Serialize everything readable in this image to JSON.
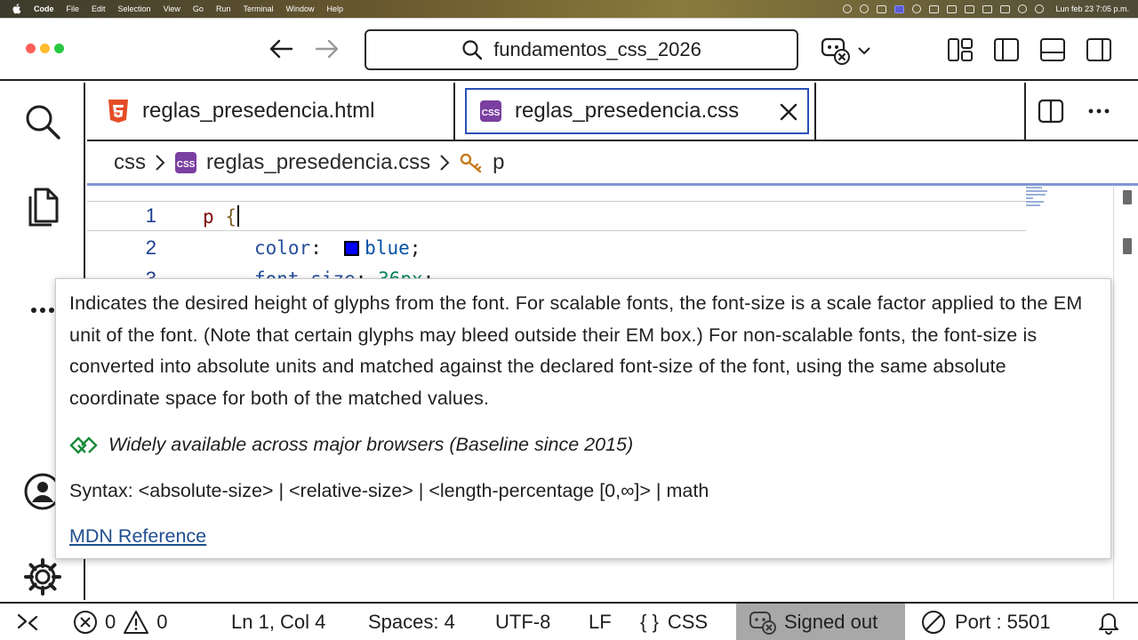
{
  "menubar": {
    "app_name": "Code",
    "items": [
      "File",
      "Edit",
      "Selection",
      "View",
      "Go",
      "Run",
      "Terminal",
      "Window",
      "Help"
    ],
    "clock": "Lun feb 23  7:05 p.m."
  },
  "titlebar": {
    "search_text": "fundamentos_css_2026",
    "icons": [
      "arrow-left-icon",
      "arrow-right-icon",
      "search-icon",
      "copilot-icon",
      "chevron-down-icon",
      "layout-icon",
      "toggle-sidebar-icon",
      "toggle-panel-icon",
      "toggle-secondary-sidebar-icon"
    ]
  },
  "activitybar": {
    "items": [
      "search-icon",
      "explorer-icon",
      "more-icon",
      "account-icon",
      "settings-icon"
    ]
  },
  "tabs": [
    {
      "label": "reglas_presedencia.html",
      "icon": "html5-icon",
      "active": false
    },
    {
      "label": "reglas_presedencia.css",
      "icon": "css-icon",
      "active": true
    }
  ],
  "breadcrumb": {
    "folder": "css",
    "file": "reglas_presedencia.css",
    "symbol": "p"
  },
  "editor": {
    "lines": [
      {
        "number": "1",
        "selector": "p",
        "open_brace": "{"
      },
      {
        "number": "2",
        "property": "color",
        "value": "blue",
        "swatch_color": "#0000ff"
      },
      {
        "number": "3",
        "property": "font-size",
        "value": "36px"
      }
    ]
  },
  "hover": {
    "description": "Indicates the desired height of glyphs from the font. For scalable fonts, the font-size is a scale factor applied to the EM unit of the font. (Note that certain glyphs may bleed outside their EM box.) For non-scalable fonts, the font-size is converted into absolute units and matched against the declared font-size of the font, using the same absolute coordinate space for both of the matched values.",
    "baseline": "Widely available across major browsers (Baseline since 2015)",
    "syntax": "Syntax: <absolute-size> | <relative-size> | <length-percentage [0,∞]> | math",
    "reference": "MDN Reference"
  },
  "statusbar": {
    "errors": "0",
    "warnings": "0",
    "position": "Ln 1, Col 4",
    "spaces": "Spaces: 4",
    "encoding": "UTF-8",
    "eol": "LF",
    "language": "CSS",
    "account": "Signed out",
    "port": "Port : 5501"
  },
  "colors": {
    "accent": "#2a4fb8",
    "html_icon": "#e44d26",
    "css_icon": "#7a3fa0",
    "account_bg": "#a8a8a8"
  }
}
